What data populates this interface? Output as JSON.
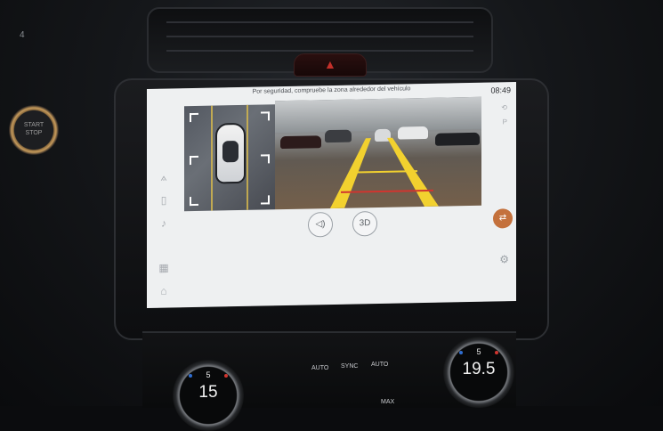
{
  "dashboard": {
    "side_number": "4",
    "start_button": {
      "line1": "START",
      "line2": "STOP"
    },
    "hazard_icon": "triangle-warning-icon"
  },
  "screen": {
    "banner": "Por seguridad, compruebe la zona alrededor del vehículo",
    "time": "08:49",
    "left_rail_icons": [
      "navigation-icon",
      "phone-icon",
      "music-icon",
      "apps-icon",
      "home-icon"
    ],
    "right_rail_icons": [
      "steering-icon",
      "parking-icon"
    ],
    "controls": {
      "sound": "sound-icon",
      "view_3d": "3D"
    },
    "camera_toggle_icon": "camera-switch-icon",
    "settings_icon": "gear-icon"
  },
  "climate": {
    "left": {
      "fan": "5",
      "temp": "15"
    },
    "right": {
      "fan": "5",
      "temp": "19.5"
    },
    "buttons": [
      "AUTO",
      "SYNC",
      "AUTO",
      "MAX"
    ]
  },
  "colors": {
    "accent": "#c4713c",
    "guide_yellow": "#f2d12f",
    "guide_red": "#d1352f"
  }
}
